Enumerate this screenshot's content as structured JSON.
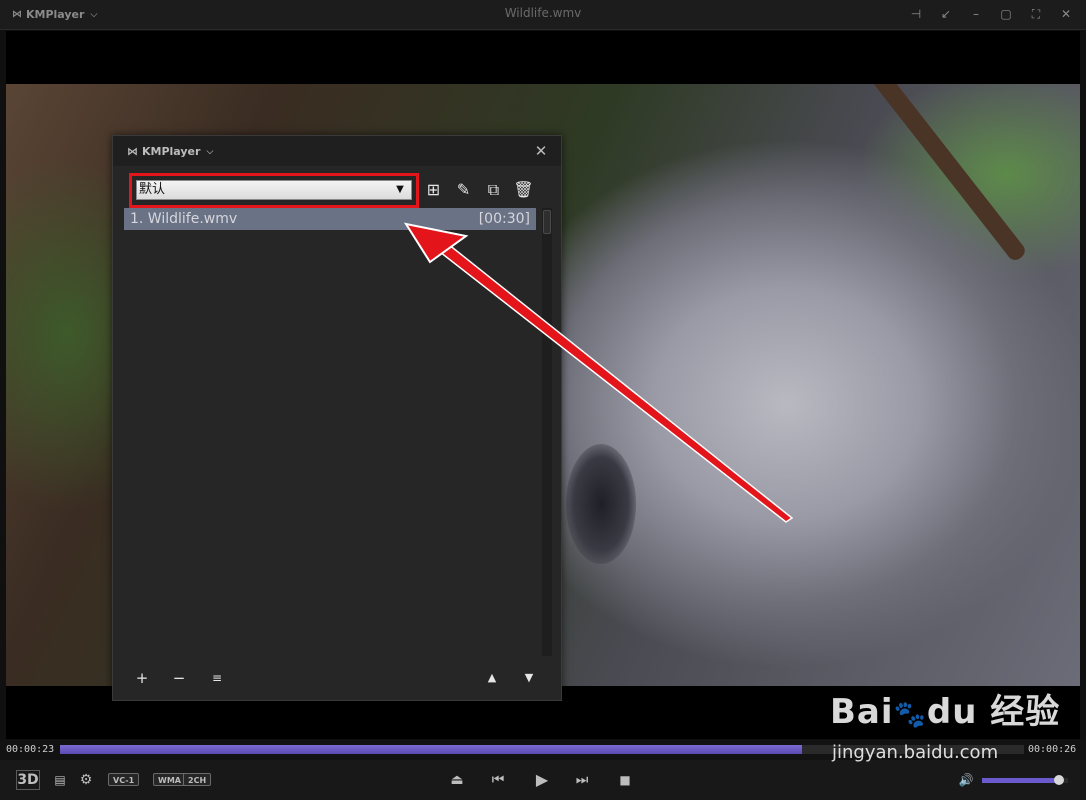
{
  "app": {
    "brand": "KMPlayer",
    "window_title": "Wildlife.wmv"
  },
  "playlist": {
    "brand": "KMPlayer",
    "selected_playlist": "默认",
    "items": [
      {
        "label": "1. Wildlife.wmv",
        "duration": "[00:30]"
      }
    ]
  },
  "playback": {
    "elapsed": "00:00:23",
    "remaining": "00:00:26",
    "progress": 0.77,
    "volume": 0.9,
    "badges": [
      "VC-1",
      "WMA",
      "2CH"
    ],
    "mode_3d": "3D"
  },
  "watermark": {
    "main": "Bai",
    "du": "du",
    "cn": "经验",
    "sub": "jingyan.baidu.com"
  },
  "colors": {
    "highlight": "#e3151b",
    "accent": "#6a5acd",
    "selected_row": "#6a7285"
  }
}
